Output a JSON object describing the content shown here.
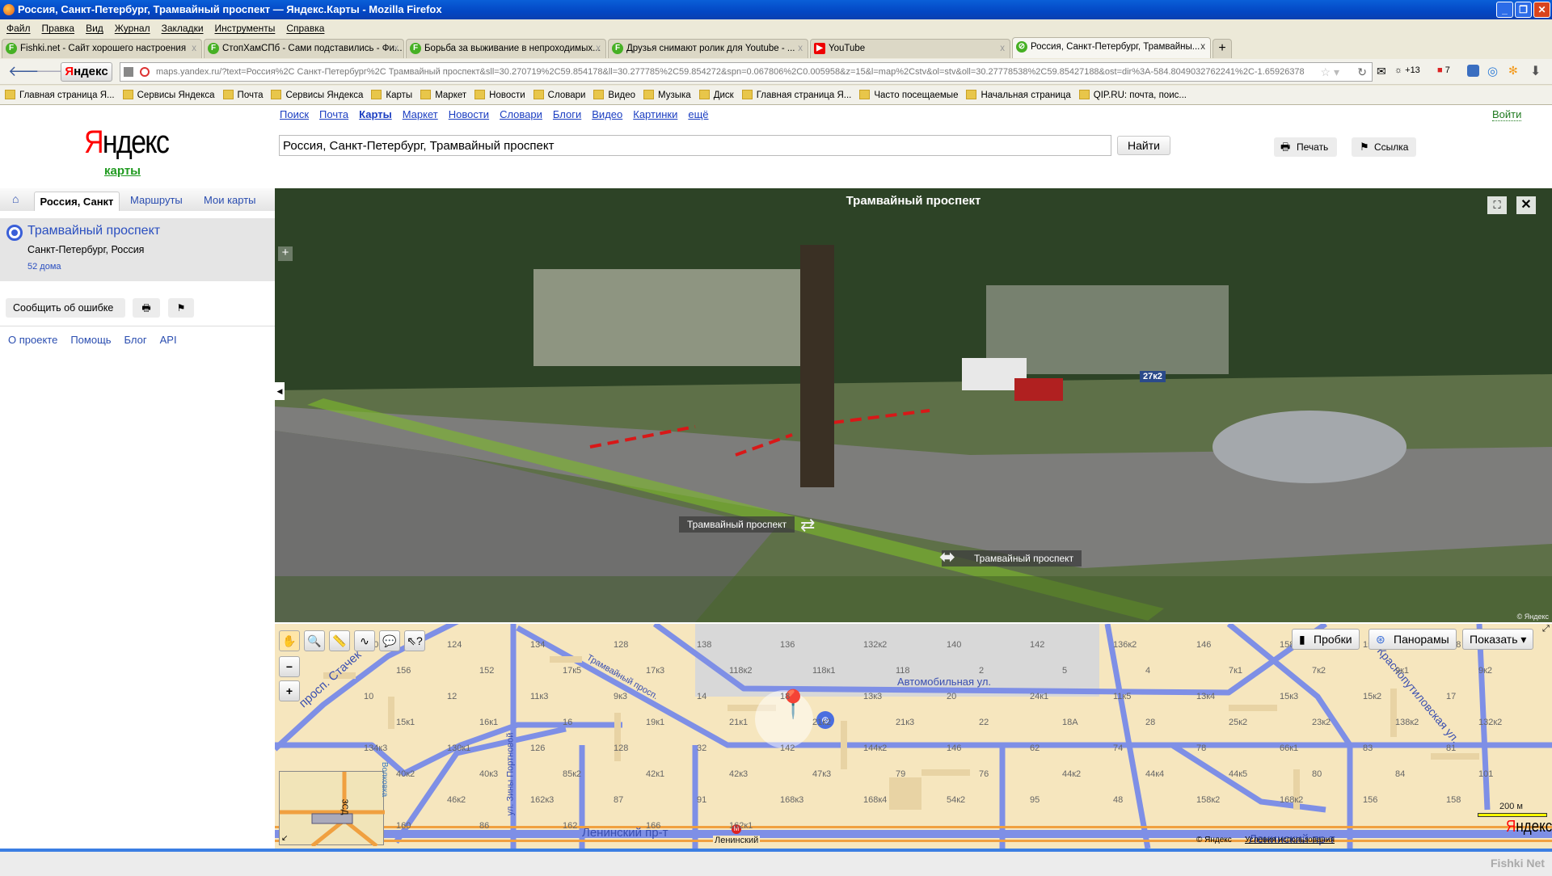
{
  "window": {
    "title": "Россия, Санкт-Петербург, Трамвайный проспект — Яндекс.Карты - Mozilla Firefox"
  },
  "menu": [
    "Файл",
    "Правка",
    "Вид",
    "Журнал",
    "Закладки",
    "Инструменты",
    "Справка"
  ],
  "tabs": [
    {
      "label": "Fishki.net - Сайт хорошего настроения",
      "icon": "fishki-icon"
    },
    {
      "label": "СтопХамСПб - Сами подставились - Фи...",
      "icon": "fishki-icon"
    },
    {
      "label": "Борьба за выживание в непроходимых...",
      "icon": "fishki-icon"
    },
    {
      "label": "Друзья снимают ролик для Youtube - ...",
      "icon": "fishki-icon"
    },
    {
      "label": "YouTube",
      "icon": "youtube-icon"
    },
    {
      "label": "Россия, Санкт-Петербург, Трамвайны...",
      "icon": "yandex-maps-icon",
      "active": true
    }
  ],
  "nav": {
    "yandex_button": "Яндекс",
    "url": "maps.yandex.ru/?text=Россия%2C Санкт-Петербург%2C Трамвайный проспект&sll=30.270719%2C59.854178&ll=30.277785%2C59.854272&spn=0.067806%2C0.005958&z=15&l=map%2Cstv&ol=stv&oll=30.27778538%2C59.85427188&ost=dir%3A-584.8049032762241%2C-1.65926378",
    "addon_count_weather": "+13",
    "addon_count_mail": "7"
  },
  "bookmarks": [
    "Главная страница Я...",
    "Сервисы Яндекса",
    "Почта",
    "Сервисы Яндекса",
    "Карты",
    "Маркет",
    "Новости",
    "Словари",
    "Видео",
    "Музыка",
    "Диск",
    "Главная страница Я...",
    "Часто посещаемые",
    "Начальная страница",
    "QIP.RU: почта, поис..."
  ],
  "header": {
    "links": [
      "Поиск",
      "Почта",
      "Карты",
      "Маркет",
      "Новости",
      "Словари",
      "Блоги",
      "Видео",
      "Картинки",
      "ещё"
    ],
    "logo": {
      "red": "Я",
      "black": "ндекс",
      "sub": "карты"
    },
    "search_value": "Россия, Санкт-Петербург, Трамвайный проспект",
    "search_button": "Найти",
    "print": "Печать",
    "link": "Ссылка",
    "login": "Войти"
  },
  "sidebar": {
    "tabs": [
      "Россия, Санкт",
      "Маршруты",
      "Мои карты"
    ],
    "result": {
      "title": "Трамвайный проспект",
      "subtitle": "Санкт-Петербург, Россия",
      "count": "52 дома"
    },
    "report_error": "Сообщить об ошибке",
    "footer_links": [
      "О проекте",
      "Помощь",
      "Блог",
      "API"
    ]
  },
  "panorama": {
    "title": "Трамвайный проспект",
    "street_labels": [
      "Трамвайный проспект",
      "Трамвайный проспект"
    ],
    "house_sign": "27к2",
    "copyright": "© Яндекс"
  },
  "map": {
    "buttons": {
      "traffic": "Пробки",
      "panoramas": "Панорамы",
      "show": "Показать ▾"
    },
    "streets": [
      "просп. Стачек",
      "Трамвайный просп.",
      "ул. Зины Портновой",
      "Ленинский пр-т",
      "Автомобильная ул.",
      "Краснопутиловская ул.",
      "Ленинский пр-т",
      "Волковка",
      "ЗСД"
    ],
    "metro": "Ленинский",
    "houses": [
      "120",
      "124",
      "134",
      "128",
      "138",
      "136",
      "132к2",
      "140",
      "142",
      "136к2",
      "146",
      "158",
      "150",
      "148",
      "156",
      "152",
      "17к5",
      "17к3",
      "118к2",
      "118к1",
      "118",
      "2",
      "5",
      "4",
      "7к1",
      "7к2",
      "9к1",
      "9к2",
      "10",
      "12",
      "11к3",
      "9к3",
      "14",
      "18",
      "13к3",
      "20",
      "24к1",
      "11к5",
      "13к4",
      "15к3",
      "15к2",
      "17",
      "15к1",
      "16к1",
      "16",
      "19к1",
      "21к1",
      "21к2",
      "21к3",
      "22",
      "18А",
      "28",
      "25к2",
      "23к2",
      "138к2",
      "132к2",
      "134к3",
      "130к1",
      "126",
      "128",
      "32",
      "142",
      "144к2",
      "146",
      "62",
      "74",
      "78",
      "66к1",
      "83",
      "81",
      "40к2",
      "40к3",
      "85к2",
      "42к1",
      "42к3",
      "47к3",
      "79",
      "76",
      "44к2",
      "44к4",
      "44к5",
      "80",
      "84",
      "101",
      "89",
      "46к2",
      "162к3",
      "87",
      "91",
      "168к3",
      "168к4",
      "54к2",
      "95",
      "48",
      "158к2",
      "168к2",
      "156",
      "158",
      "160",
      "86",
      "162",
      "166",
      "162к1"
    ],
    "scale": "200 м",
    "copyright": "© Яндекс",
    "terms": "Условия использования",
    "logo": "Яндекс"
  },
  "watermark": "Fishki Net"
}
